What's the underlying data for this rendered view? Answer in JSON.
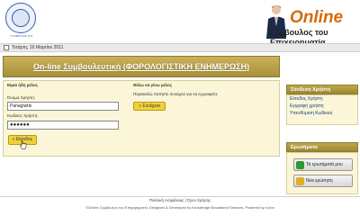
{
  "header": {
    "logo_caption": "ΣΥΜΒΟΥΛΟΣ ΤΟΥ ΕΠΙΧΕΙΡΗΜΑΤΙΑ",
    "brand": "Online",
    "tagline": "Σύμβουλος του Επιχειρηματία"
  },
  "datebar": {
    "date": "Τετάρτη, 16 Μαρτίου 2011"
  },
  "banner": {
    "title": "On-line Συμβουλευτική (ΦΟΡΟΛΟΓΙΣΤΙΚΗ ΕΝΗΜΕΡΩΣΗ)"
  },
  "login": {
    "heading": "Είμαι ήδη μέλος",
    "username_label": "Όνομα Χρήστη:",
    "username_value": "Panagiwtis",
    "password_label": "Κωδικός Χρήστη:",
    "password_value": "●●●●●●",
    "submit_label": "» Είσοδος"
  },
  "join": {
    "heading": "Θέλω να γίνω μέλος",
    "text": "Παρακαλώ πατήστε συνέχεια για να εγγραφείτε",
    "continue_label": "» Συνέχεια"
  },
  "sidebar": {
    "user_login": {
      "title": "Σύνδεση Χρήστη",
      "links": [
        "Είσοδος Χρήστη",
        "Εγγραφή χρήστη",
        "Υπενθύμιση Κωδικού"
      ]
    },
    "questions": {
      "title": "Ερωτήματα",
      "buttons": [
        "Τα ερωτήματά μου",
        "Νέα ερώτηση"
      ]
    }
  },
  "footer": {
    "links": "Πολιτική Ασφάλειας | Όροι Χρήσης",
    "copyright": "©Online Σύμβουλος του Επιχειρηματία, Designed & Developed by Knowledge Broadband Services, Powered by e-box"
  }
}
